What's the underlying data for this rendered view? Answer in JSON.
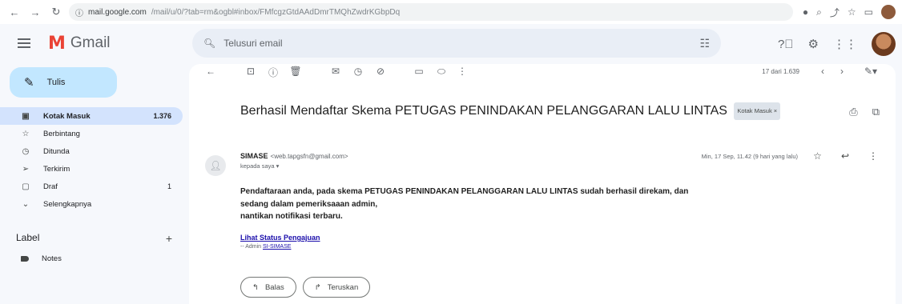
{
  "browser": {
    "url": "mail.google.com/mail/u/0/?tab=rm&ogbl#inbox/FMfcgzGtdAAdDmrTMQhZwdrKGbpDq",
    "url_host": "mail.google.com",
    "url_rest": "/mail/u/0/?tab=rm&ogbl#inbox/FMfcgzGtdAAdDmrTMQhZwdrKGbpDq"
  },
  "app": {
    "name": "Gmail",
    "search_placeholder": "Telusuri email"
  },
  "sidebar": {
    "compose_label": "Tulis",
    "items": [
      {
        "label": "Kotak Masuk",
        "count": "1.376",
        "icon": "inbox-icon"
      },
      {
        "label": "Berbintang",
        "count": "",
        "icon": "star-icon"
      },
      {
        "label": "Ditunda",
        "count": "",
        "icon": "clock-icon"
      },
      {
        "label": "Terkirim",
        "count": "",
        "icon": "send-icon"
      },
      {
        "label": "Draf",
        "count": "1",
        "icon": "draft-icon"
      },
      {
        "label": "Selengkapnya",
        "count": "",
        "icon": "chevron-down-icon"
      }
    ],
    "labels_title": "Label",
    "labels": [
      {
        "label": "Notes"
      }
    ]
  },
  "toolbar": {
    "pager": "17 dari 1.639"
  },
  "message": {
    "subject": "Berhasil Mendaftar Skema PETUGAS PENINDAKAN PELANGGARAN LALU LINTAS",
    "chip": "Kotak Masuk ×",
    "sender_name": "SIMASE",
    "sender_email": "<web.tapgsfn@gmail.com>",
    "to_line": "kepada saya ▾",
    "date": "Min, 17 Sep, 11.42 (9 hari yang lalu)",
    "body_lines": [
      "Pendaftaraan anda, pada skema PETUGAS PENINDAKAN PELANGGARAN LALU LINTAS sudah berhasil direkam, dan",
      "sedang dalam pemeriksaaan admin,",
      "nantikan notifikasi terbaru."
    ],
    "status_link": "Lihat Status Pengajuan",
    "admin_prefix": "-- Admin",
    "admin_link": "SI-SIMASE"
  },
  "actions": {
    "reply": "Balas",
    "forward": "Teruskan"
  }
}
